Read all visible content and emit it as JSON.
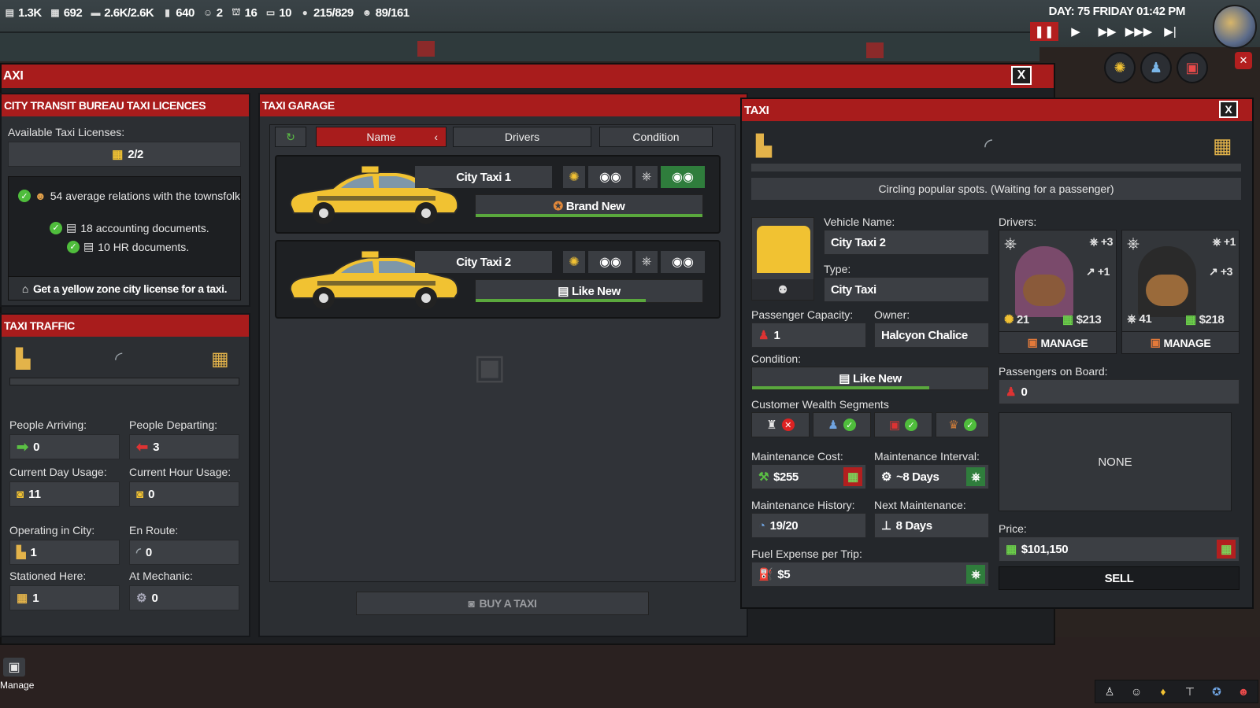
{
  "hud": {
    "stats": [
      {
        "icon": "building-icon",
        "value": "1.3K"
      },
      {
        "icon": "document-icon",
        "value": "692"
      },
      {
        "icon": "cash-stack-icon",
        "value": "2.6K/2.6K"
      },
      {
        "icon": "battery-icon",
        "value": "640"
      },
      {
        "icon": "people-icon",
        "value": "2"
      },
      {
        "icon": "water-tower-icon",
        "value": "16"
      },
      {
        "icon": "bus-icon",
        "value": "10"
      },
      {
        "icon": "police-icon",
        "value": "215/829"
      },
      {
        "icon": "criminal-icon",
        "value": "89/161"
      }
    ],
    "clock": "DAY: 75   FRIDAY   01:42 PM"
  },
  "main_window": {
    "title": "AXI",
    "close": "X"
  },
  "licences": {
    "title": "CITY TRANSIT BUREAU TAXI LICENCES",
    "available_label": "Available Taxi Licenses:",
    "available_value": "2/2",
    "requirements": [
      "54 average relations with the townsfolk",
      "18 accounting documents.",
      "10 HR documents."
    ],
    "cta": "Get a yellow zone city license for a taxi."
  },
  "traffic": {
    "title": "TAXI TRAFFIC",
    "people_arriving_label": "People Arriving:",
    "people_arriving": "0",
    "people_departing_label": "People Departing:",
    "people_departing": "3",
    "day_usage_label": "Current Day Usage:",
    "day_usage": "11",
    "hour_usage_label": "Current Hour Usage:",
    "hour_usage": "0",
    "operating_label": "Operating in City:",
    "operating": "1",
    "en_route_label": "En Route:",
    "en_route": "0",
    "stationed_label": "Stationed Here:",
    "stationed": "1",
    "mechanic_label": "At Mechanic:",
    "mechanic": "0"
  },
  "garage": {
    "title": "TAXI GARAGE",
    "tabs": [
      "Name",
      "Drivers",
      "Condition"
    ],
    "taxis": [
      {
        "name": "City Taxi 1",
        "condition": "Brand New",
        "condition_level": 1.0
      },
      {
        "name": "City Taxi 2",
        "condition": "Like New",
        "condition_level": 0.75
      }
    ],
    "buy_button": "BUY A TAXI"
  },
  "taxi": {
    "title": "TAXI",
    "close": "X",
    "status": "Circling popular spots. (Waiting for a passenger)",
    "vehicle_name_label": "Vehicle Name:",
    "vehicle_name": "City Taxi 2",
    "type_label": "Type:",
    "type": "City Taxi",
    "capacity_label": "Passenger Capacity:",
    "capacity": "1",
    "owner_label": "Owner:",
    "owner": "Halcyon Chalice",
    "condition_label": "Condition:",
    "condition": "Like New",
    "condition_level": 0.75,
    "wealth_label": "Customer Wealth Segments",
    "wealth_segments": [
      {
        "icon": "poor-icon",
        "allowed": false
      },
      {
        "icon": "middle-class-icon",
        "allowed": true
      },
      {
        "icon": "wealthy-icon",
        "allowed": true
      },
      {
        "icon": "rich-icon",
        "allowed": true
      }
    ],
    "maint_cost_label": "Maintenance Cost:",
    "maint_cost": "$255",
    "maint_interval_label": "Maintenance Interval:",
    "maint_interval": "~8 Days",
    "maint_history_label": "Maintenance History:",
    "maint_history": "19/20",
    "next_maint_label": "Next Maintenance:",
    "next_maint": "8 Days",
    "fuel_label": "Fuel Expense per Trip:",
    "fuel": "$5",
    "drivers_label": "Drivers:",
    "drivers": [
      {
        "skill": "+3",
        "bonus": "+1",
        "stat": "21",
        "wage": "$213",
        "manage": "MANAGE"
      },
      {
        "skill": "+1",
        "bonus": "+3",
        "stat": "41",
        "wage": "$218",
        "manage": "MANAGE"
      }
    ],
    "passengers_label": "Passengers on Board:",
    "passengers": "0",
    "passenger_list": "NONE",
    "price_label": "Price:",
    "price": "$101,150",
    "sell": "SELL"
  },
  "corner": {
    "manage": "Manage"
  }
}
